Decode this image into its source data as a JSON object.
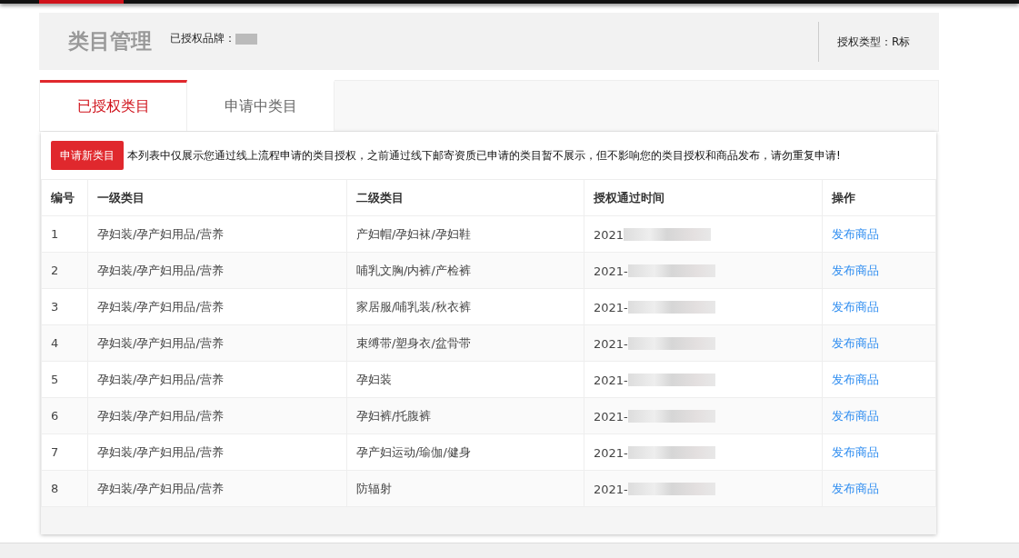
{
  "header": {
    "title": "类目管理",
    "brand_label": "已授权品牌：",
    "auth_type": "授权类型：R标"
  },
  "tabs": [
    {
      "label": "已授权类目",
      "selected": true
    },
    {
      "label": "申请中类目",
      "selected": false
    }
  ],
  "apply_button": "申请新类目",
  "notice": "本列表中仅展示您通过线上流程申请的类目授权，之前通过线下邮寄资质已申请的类目暂不展示，但不影响您的类目授权和商品发布，请勿重复申请!",
  "table": {
    "columns": [
      "编号",
      "一级类目",
      "二级类目",
      "授权通过时间",
      "操作"
    ],
    "rows": [
      {
        "no": "1",
        "level1": "孕妇装/孕产妇用品/营养",
        "level2": "产妇帽/孕妇袜/孕妇鞋",
        "time": "2021",
        "action": "发布商品"
      },
      {
        "no": "2",
        "level1": "孕妇装/孕产妇用品/营养",
        "level2": "哺乳文胸/内裤/产检裤",
        "time": "2021-",
        "action": "发布商品"
      },
      {
        "no": "3",
        "level1": "孕妇装/孕产妇用品/营养",
        "level2": "家居服/哺乳装/秋衣裤",
        "time": "2021-",
        "action": "发布商品"
      },
      {
        "no": "4",
        "level1": "孕妇装/孕产妇用品/营养",
        "level2": "束缚带/塑身衣/盆骨带",
        "time": "2021-",
        "action": "发布商品"
      },
      {
        "no": "5",
        "level1": "孕妇装/孕产妇用品/营养",
        "level2": "孕妇装",
        "time": "2021-",
        "action": "发布商品"
      },
      {
        "no": "6",
        "level1": "孕妇装/孕产妇用品/营养",
        "level2": "孕妇裤/托腹裤",
        "time": "2021-",
        "action": "发布商品"
      },
      {
        "no": "7",
        "level1": "孕妇装/孕产妇用品/营养",
        "level2": "孕产妇运动/瑜伽/健身",
        "time": "2021-",
        "action": "发布商品"
      },
      {
        "no": "8",
        "level1": "孕妇装/孕产妇用品/营养",
        "level2": "防辐射",
        "time": "2021-",
        "action": "发布商品"
      }
    ]
  }
}
